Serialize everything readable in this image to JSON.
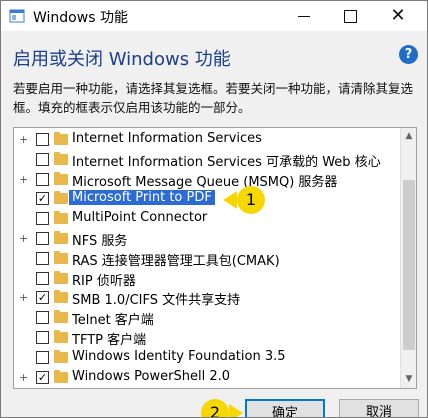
{
  "window": {
    "title": "Windows 功能",
    "controls": {
      "minimize": "—",
      "close": "✕"
    }
  },
  "header": {
    "heading": "启用或关闭 Windows 功能",
    "help": "?",
    "description": "若要启用一种功能，请选择其复选框。若要关闭一种功能，请清除其复选框。填充的框表示仅启用该功能的一部分。"
  },
  "features": [
    {
      "label": "Internet Information Services",
      "expander": "+",
      "check": ""
    },
    {
      "label": "Internet Information Services 可承载的 Web 核心",
      "expander": "",
      "check": ""
    },
    {
      "label": "Microsoft Message Queue (MSMQ) 服务器",
      "expander": "+",
      "check": ""
    },
    {
      "label": "Microsoft Print to PDF",
      "expander": "",
      "check": "✓",
      "selected": true
    },
    {
      "label": "MultiPoint Connector",
      "expander": "",
      "check": ""
    },
    {
      "label": "NFS 服务",
      "expander": "+",
      "check": ""
    },
    {
      "label": "RAS 连接管理器管理工具包(CMAK)",
      "expander": "",
      "check": ""
    },
    {
      "label": "RIP 侦听器",
      "expander": "",
      "check": ""
    },
    {
      "label": "SMB 1.0/CIFS 文件共享支持",
      "expander": "+",
      "check": "✓"
    },
    {
      "label": "Telnet 客户端",
      "expander": "",
      "check": ""
    },
    {
      "label": "TFTP 客户端",
      "expander": "",
      "check": ""
    },
    {
      "label": "Windows Identity Foundation 3.5",
      "expander": "",
      "check": ""
    },
    {
      "label": "Windows PowerShell 2.0",
      "expander": "+",
      "check": "✓"
    }
  ],
  "scrollbar": {
    "up": "▲",
    "down": "▼"
  },
  "callouts": {
    "one": "1",
    "two": "2"
  },
  "buttons": {
    "ok": "确定",
    "cancel": "取消"
  },
  "colors": {
    "accent": "#0078d7",
    "selection": "#2d6bd4",
    "callout": "#f6d800",
    "heading": "#1a3f8f"
  }
}
